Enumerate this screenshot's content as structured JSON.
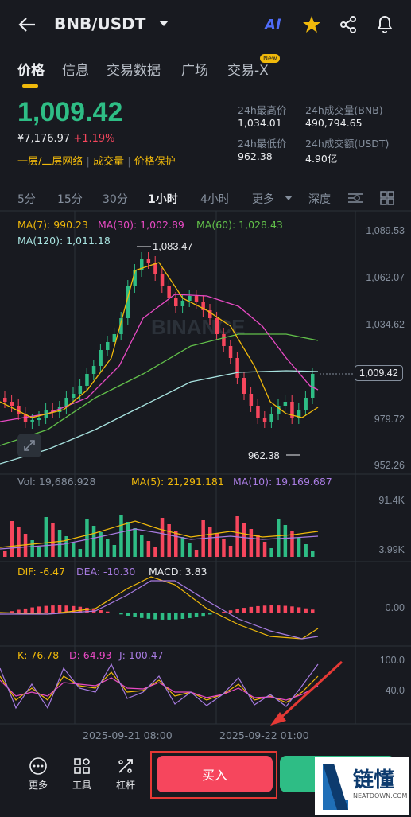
{
  "header": {
    "pair": "BNB/USDT",
    "ai_label": "Ai"
  },
  "tabs": [
    "价格",
    "信息",
    "交易数据",
    "广场",
    "交易-X"
  ],
  "new_badge": "New",
  "ticker": {
    "last_price": "1,009.42",
    "cny": "¥7,176.97",
    "change": "+1.19%",
    "links": [
      "一层/二层网络",
      "成交量",
      "价格保护"
    ]
  },
  "stats": {
    "high_label": "24h最高价",
    "high": "1,034.01",
    "vol_label": "24h成交量(BNB)",
    "vol": "490,794.65",
    "low_label": "24h最低价",
    "low": "962.38",
    "turnover_label": "24h成交额(USDT)",
    "turnover": "4.90亿"
  },
  "timeframes": [
    "5分",
    "15分",
    "30分",
    "1小时",
    "4小时",
    "更多",
    "深度"
  ],
  "ma_labels": {
    "ma7": "MA(7): 990.23",
    "ma30": "MA(30): 1,002.89",
    "ma60": "MA(60): 1,028.43",
    "ma120": "MA(120): 1,011.18"
  },
  "price_axis": [
    "1,089.53",
    "1,062.07",
    "1,034.62",
    "1,009.42",
    "979.72",
    "952.26"
  ],
  "annotations": {
    "high": "1,083.47",
    "low": "962.38"
  },
  "watermark": "BINANCE",
  "volume": {
    "vol": "Vol: 19,686.928",
    "ma5": "MA(5): 21,291.181",
    "ma10": "MA(10): 19,169.687",
    "axis_top": "91.4K",
    "axis_bottom": "3.99K"
  },
  "macd": {
    "dif": "DIF: -6.47",
    "dea": "DEA: -10.30",
    "macd": "MACD: 3.83",
    "axis": "0.00"
  },
  "kdj": {
    "k": "K: 76.78",
    "d": "D: 64.93",
    "j": "J: 100.47",
    "axis_top": "100.0",
    "axis_mid": "40.0"
  },
  "time_axis": [
    "2025-09-21 08:00",
    "2025-09-22 01:00"
  ],
  "bottom": {
    "more": "更多",
    "tools": "工具",
    "leverage": "杠杆",
    "buy": "买入"
  },
  "watermark_logo": {
    "cn": "链懂",
    "en": "NEATDOWN.COM"
  },
  "colors": {
    "up": "#2ebd85",
    "down": "#f6465d",
    "accent": "#f0b90b",
    "ma7": "#f0b90b",
    "ma30": "#e84ac4",
    "ma60": "#62c14a",
    "ma120": "#a8e3e0"
  }
}
